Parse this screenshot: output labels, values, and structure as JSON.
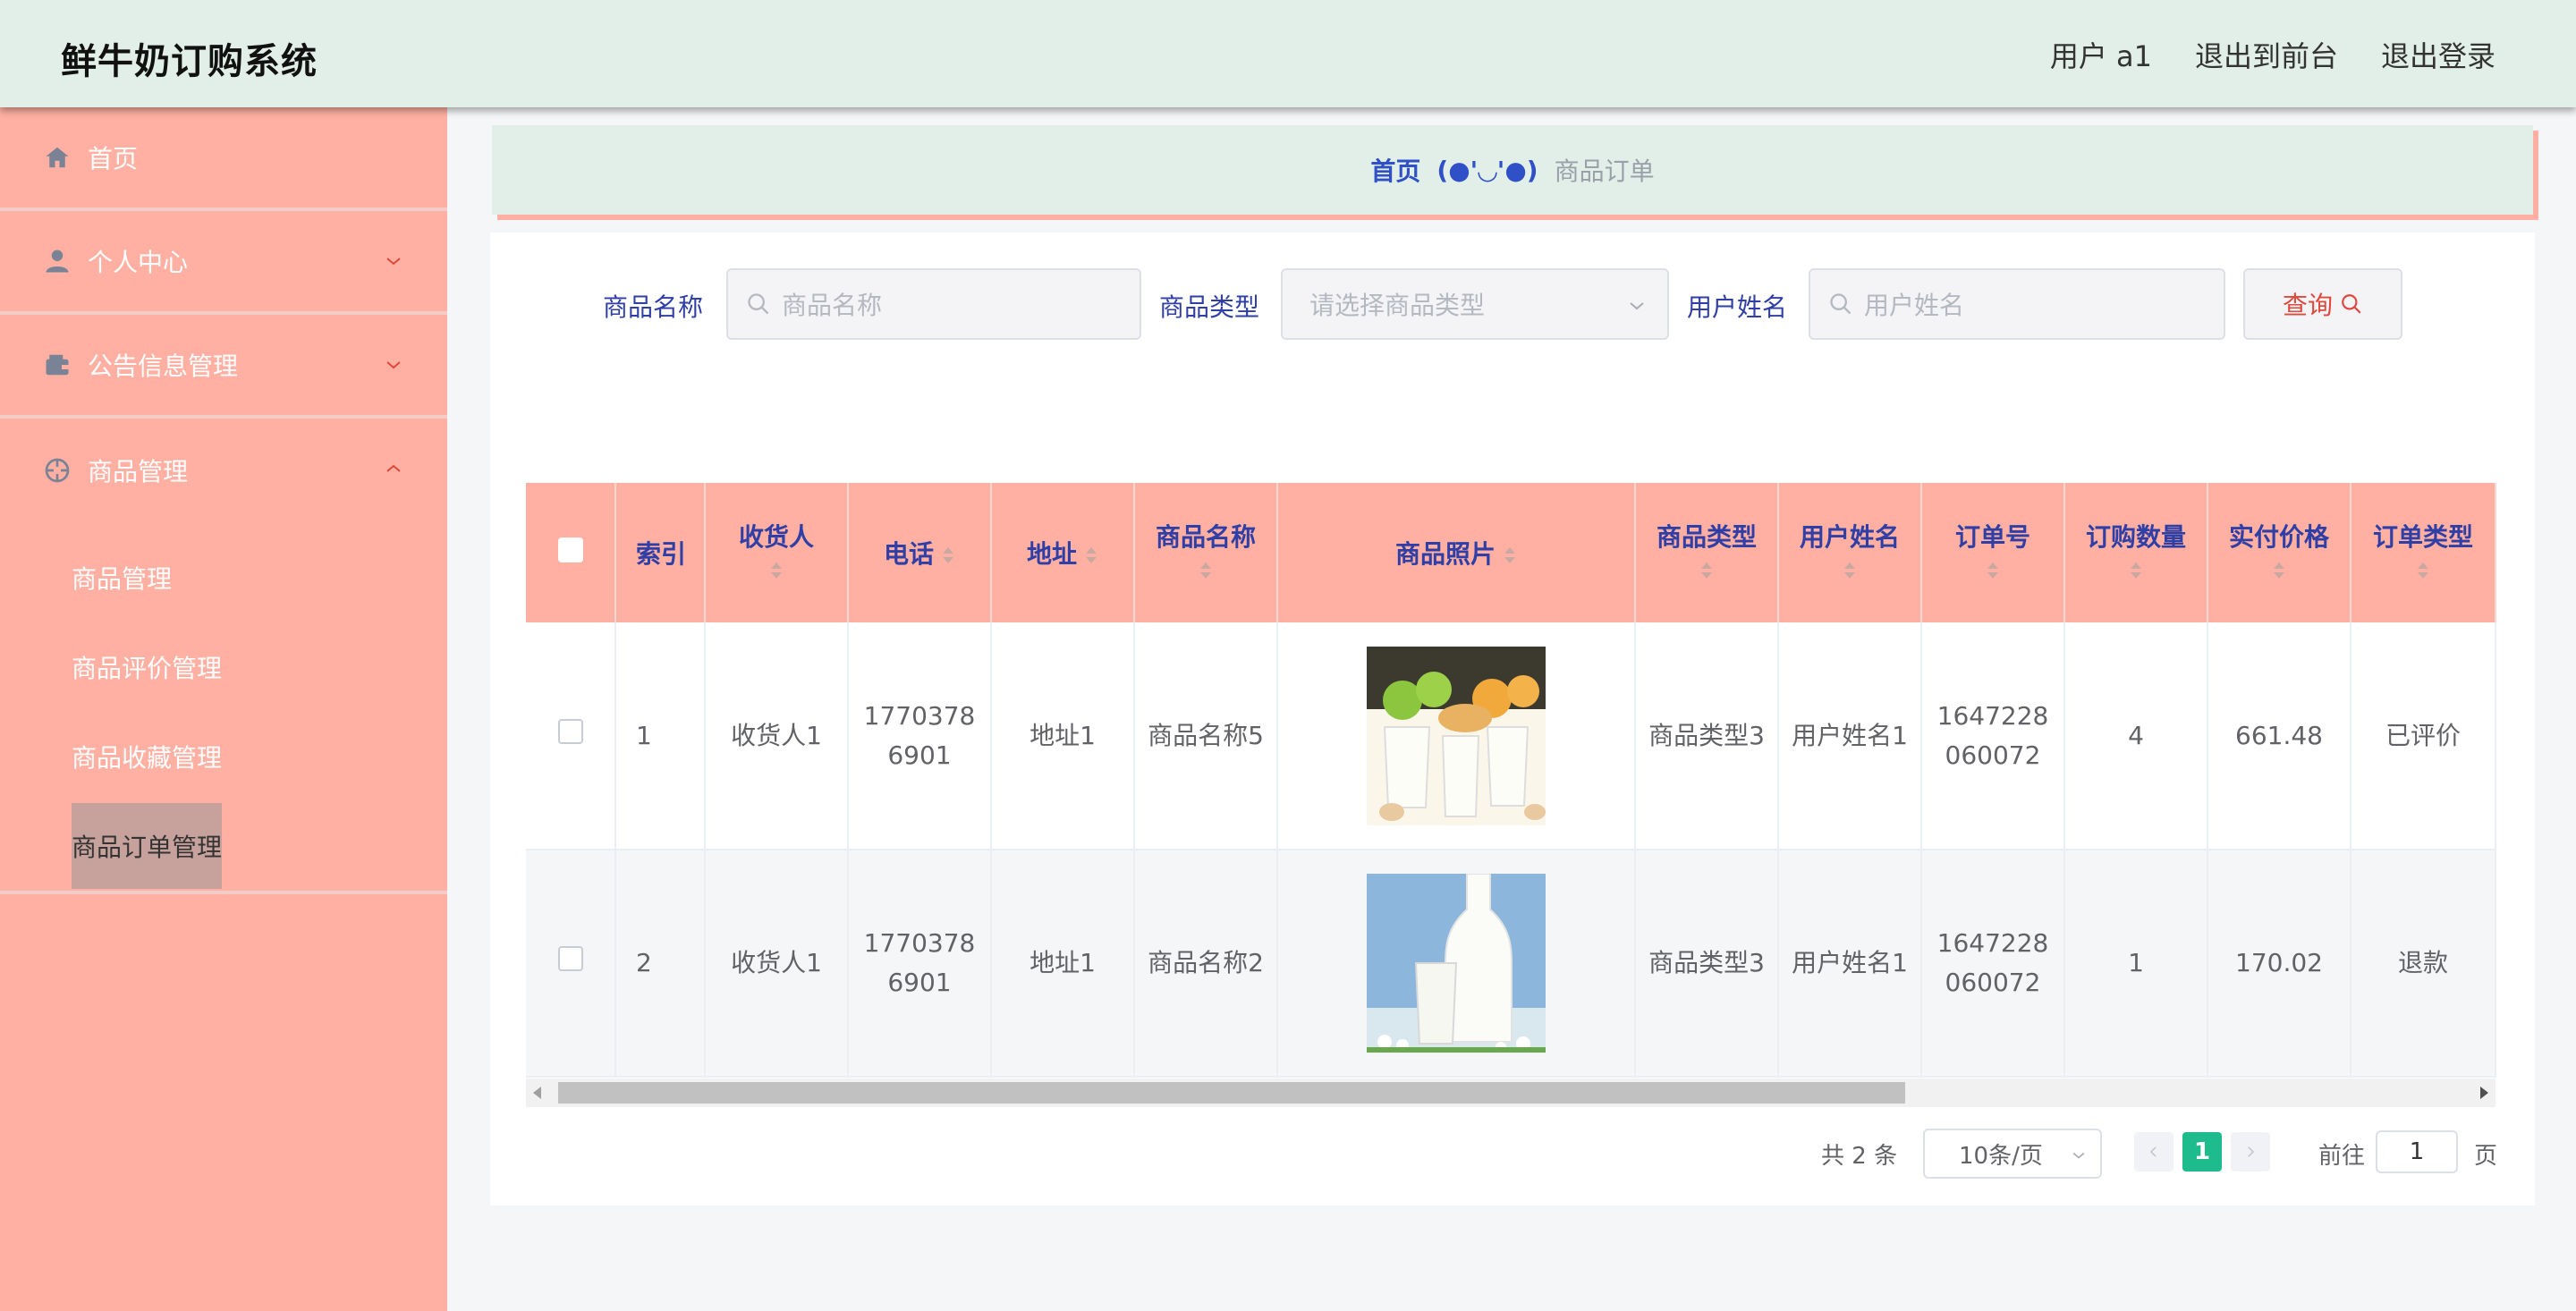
{
  "header": {
    "app_title": "鲜牛奶订购系统",
    "user_label": "用户 a1",
    "back_front_label": "退出到前台",
    "logout_label": "退出登录"
  },
  "sidebar": {
    "items": [
      {
        "label": "首页",
        "icon": "home-icon"
      },
      {
        "label": "个人中心",
        "icon": "user-icon",
        "expandable": true
      },
      {
        "label": "公告信息管理",
        "icon": "wallet-icon",
        "expandable": true
      },
      {
        "label": "商品管理",
        "icon": "compass-icon",
        "expanded": true
      }
    ],
    "subitems": [
      {
        "label": "商品管理"
      },
      {
        "label": "商品评价管理"
      },
      {
        "label": "商品收藏管理"
      },
      {
        "label": "商品订单管理",
        "active": true
      }
    ]
  },
  "breadcrumb": {
    "home": "首页",
    "separator": "(●'◡'●)",
    "current": "商品订单"
  },
  "search": {
    "name_label": "商品名称",
    "name_placeholder": "商品名称",
    "type_label": "商品类型",
    "type_placeholder": "请选择商品类型",
    "user_label": "用户姓名",
    "user_placeholder": "用户姓名",
    "query_label": "查询"
  },
  "table": {
    "headers": [
      "索引",
      "收货人",
      "电话",
      "地址",
      "商品名称",
      "商品照片",
      "商品类型",
      "用户姓名",
      "订单号",
      "订购数量",
      "实付价格",
      "订单类型"
    ],
    "rows": [
      {
        "index": "1",
        "receiver": "收货人1",
        "phone": "17703786901",
        "address": "地址1",
        "product_name": "商品名称5",
        "photo": "milk-glasses-with-fruit",
        "product_type": "商品类型3",
        "user_name": "用户姓名1",
        "order_no": "1647228060072",
        "quantity": "4",
        "price": "661.48",
        "order_type": "已评价"
      },
      {
        "index": "2",
        "receiver": "收货人1",
        "phone": "17703786901",
        "address": "地址1",
        "product_name": "商品名称2",
        "photo": "milk-bottle-with-glass",
        "product_type": "商品类型3",
        "user_name": "用户姓名1",
        "order_no": "1647228060072",
        "quantity": "1",
        "price": "170.02",
        "order_type": "退款"
      }
    ]
  },
  "pagination": {
    "total_text": "共 2 条",
    "page_size": "10条/页",
    "current_page": "1",
    "goto_label": "前往",
    "goto_value": "1",
    "goto_suffix": "页"
  },
  "colors": {
    "header_bg": "#e1efe8",
    "sidebar_bg": "#ffb0a2",
    "table_header_bg": "#ffb0a2",
    "label_blue": "#2f3fa6",
    "query_red": "#e0473d",
    "pager_active": "#1ebc8c"
  }
}
